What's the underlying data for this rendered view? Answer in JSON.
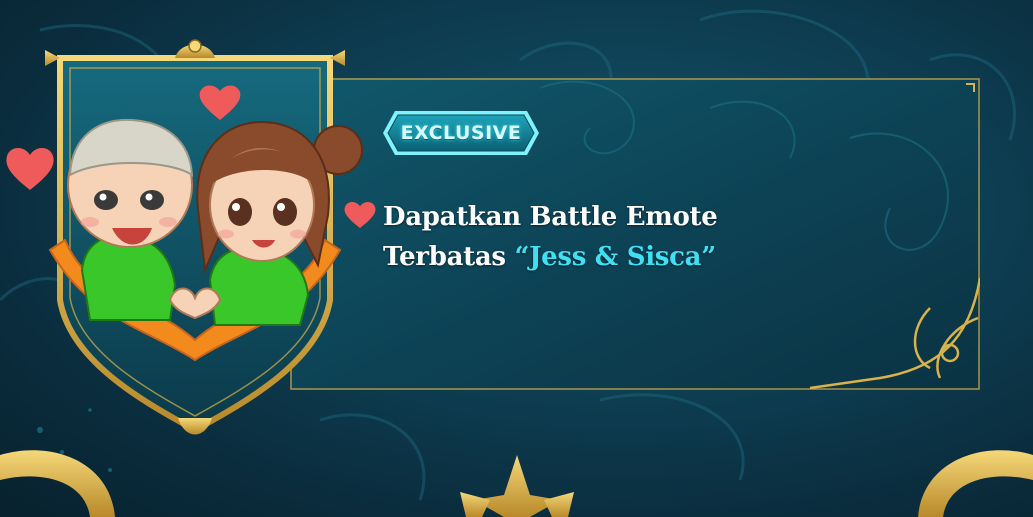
{
  "badge": {
    "label": "EXCLUSIVE"
  },
  "reward": {
    "line1": "Dapatkan Battle Emote",
    "line2_prefix": "Terbatas ",
    "line2_highlight": "“Jess & Sisca”"
  },
  "colors": {
    "background": "#0e3f53",
    "panel": "#0f4457",
    "gold": "#d9b24a",
    "accent_cyan": "#3fe0f2",
    "heart": "#ef5a5a",
    "hoodie": "#3ac72a"
  },
  "icons": [
    "heart-icon",
    "crown-icon",
    "gold-corner-ornament"
  ]
}
